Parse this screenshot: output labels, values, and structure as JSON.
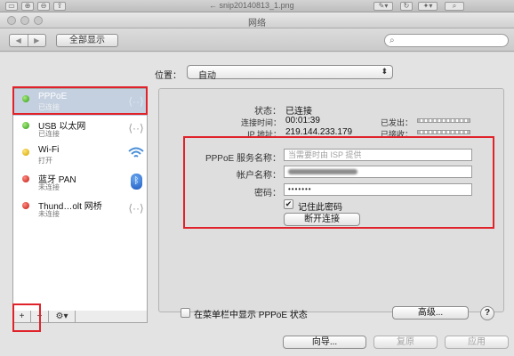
{
  "app": {
    "title": "← snip20140813_1.png"
  },
  "window": {
    "title": "网络"
  },
  "toolbar": {
    "back": "◀",
    "forward": "▶",
    "show_all": "全部显示",
    "search_placeholder": ""
  },
  "location": {
    "label": "位置：",
    "value": "自动"
  },
  "services": [
    {
      "name": "PPPoE",
      "status": "已连接",
      "dot": "green",
      "icon": "double-arrow-icon"
    },
    {
      "name": "USB 以太网",
      "status": "已连接",
      "dot": "green",
      "icon": "double-arrow-icon"
    },
    {
      "name": "Wi-Fi",
      "status": "打开",
      "dot": "yellow",
      "icon": "wifi-icon"
    },
    {
      "name": "蓝牙 PAN",
      "status": "未连接",
      "dot": "red",
      "icon": "bluetooth-icon"
    },
    {
      "name": "Thund…olt 网桥",
      "status": "未连接",
      "dot": "red",
      "icon": "double-arrow-icon"
    }
  ],
  "sidebar_tools": {
    "add": "+",
    "remove": "−",
    "gear": "⚙▾"
  },
  "status": {
    "status_label": "状态：",
    "status_value": "已连接",
    "time_label": "连接时间：",
    "time_value": "00:01:39",
    "ip_label": "IP 地址：",
    "ip_value": "219.144.233.179",
    "sent_label": "已发出：",
    "received_label": "已接收："
  },
  "form": {
    "service_label": "PPPoE 服务名称：",
    "service_placeholder": "当需要时由 ISP 提供",
    "account_label": "帐户名称：",
    "password_label": "密码：",
    "password_value": "•••••••",
    "remember_label": "记住此密码",
    "remember_checked": "✔",
    "disconnect_label": "断开连接"
  },
  "footer": {
    "menubar_label": "在菜单栏中显示 PPPoE 状态",
    "advanced_label": "高级...",
    "help_label": "?",
    "assist_label": "向导...",
    "revert_label": "复原",
    "apply_label": "应用"
  },
  "colors": {
    "selection": "#c4d0e0",
    "annotation_red": "#e0232b"
  }
}
